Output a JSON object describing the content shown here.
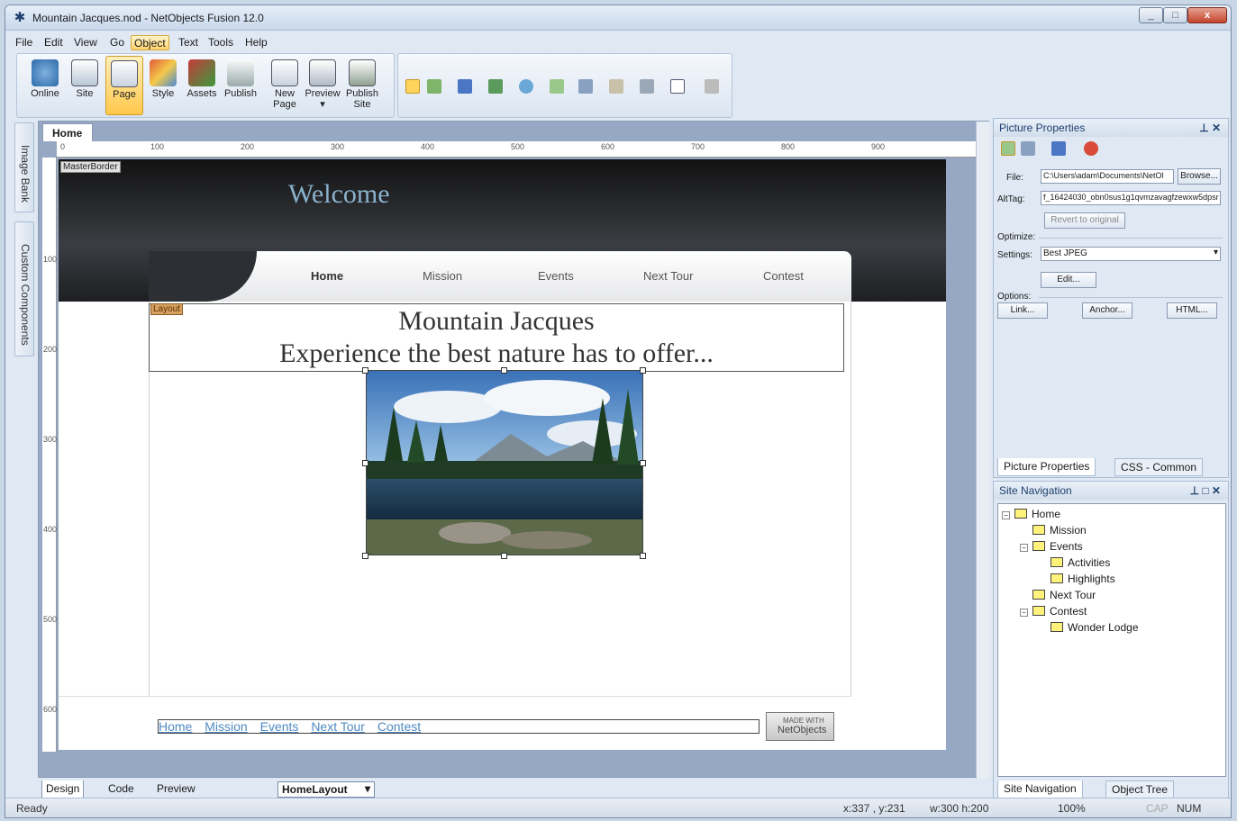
{
  "window": {
    "title": "Mountain Jacques.nod - NetObjects Fusion 12.0",
    "min": "_",
    "max": "□",
    "close": "x"
  },
  "menu": [
    "File",
    "Edit",
    "View",
    "Go",
    "Object",
    "Text",
    "Tools",
    "Help"
  ],
  "toolbar": {
    "main": [
      "Online",
      "Site",
      "Page",
      "Style",
      "Assets",
      "Publish"
    ],
    "new_page": [
      "New",
      "Page"
    ],
    "preview": "Preview",
    "publish_site": [
      "Publish",
      "Site"
    ]
  },
  "left_tabs": [
    "Image Bank",
    "Custom Components"
  ],
  "document": {
    "tab": "Home",
    "ruler_h": [
      "0",
      "100",
      "200",
      "300",
      "400",
      "500",
      "600",
      "700",
      "800",
      "900"
    ],
    "ruler_v": [
      "100",
      "200",
      "300",
      "400",
      "500",
      "600"
    ],
    "masterborder_label": "MasterBorder",
    "welcome": "Welcome",
    "nav": [
      "Home",
      "Mission",
      "Events",
      "Next Tour",
      "Contest"
    ],
    "layout_label": "Layout",
    "headline_1": "Mountain Jacques",
    "headline_2": "Experience the best nature has to offer...",
    "footer_links": [
      "Home",
      "Mission",
      "Events",
      "Next Tour",
      "Contest"
    ],
    "badge_1": "MADE WITH",
    "badge_2": "NetObjects"
  },
  "bottom_tabs": {
    "design": "Design",
    "code": "Code",
    "preview": "Preview",
    "layout": "HomeLayout"
  },
  "picture_properties": {
    "title": "Picture Properties",
    "file_label": "File:",
    "file_value": "C:\\Users\\adam\\Documents\\NetOl",
    "browse": "Browse...",
    "alttag_label": "AltTag:",
    "alttag_value": "f_16424030_obn0sus1g1qvmzavagfzewxw5dpsr",
    "revert": "Revert to original",
    "optimize": "Optimize:",
    "settings_label": "Settings:",
    "settings_value": "Best JPEG",
    "edit": "Edit...",
    "options": "Options:",
    "link": "Link...",
    "anchor": "Anchor...",
    "html": "HTML...",
    "tabs": [
      "Picture Properties",
      "CSS - Common"
    ]
  },
  "site_navigation": {
    "title": "Site Navigation",
    "tree": [
      {
        "label": "Home",
        "level": 0
      },
      {
        "label": "Mission",
        "level": 1
      },
      {
        "label": "Events",
        "level": 1
      },
      {
        "label": "Activities",
        "level": 2
      },
      {
        "label": "Highlights",
        "level": 2
      },
      {
        "label": "Next Tour",
        "level": 1
      },
      {
        "label": "Contest",
        "level": 1
      },
      {
        "label": "Wonder Lodge",
        "level": 2
      }
    ],
    "tabs": [
      "Site Navigation",
      "Object Tree"
    ]
  },
  "status": {
    "ready": "Ready",
    "coords": "x:337 , y:231",
    "size": "w:300 h:200",
    "zoom": "100%",
    "cap": "CAP",
    "num": "NUM"
  },
  "colors": {
    "accent": "#ffc84a",
    "nav_link": "#4f8bc4",
    "welcome": "#8ab2cc"
  }
}
